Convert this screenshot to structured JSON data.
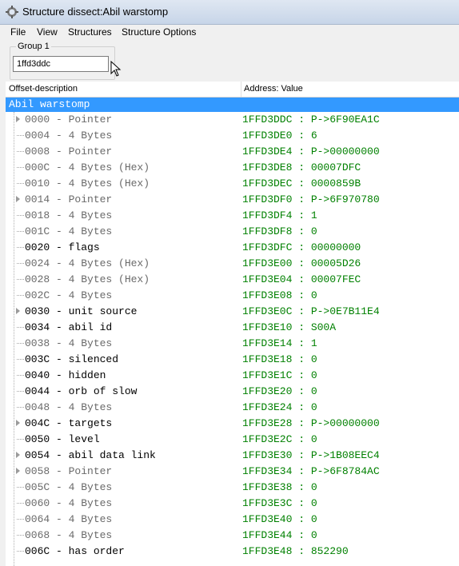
{
  "window": {
    "title": "Structure dissect:Abil warstomp"
  },
  "menu": [
    "File",
    "View",
    "Structures",
    "Structure Options"
  ],
  "group": {
    "label": "Group 1",
    "address": "1ffd3ddc"
  },
  "columns": {
    "offset": "Offset-description",
    "value": "Address: Value"
  },
  "root": {
    "label": "Abil warstomp"
  },
  "rows": [
    {
      "desc": "0000 - Pointer",
      "val": "1FFD3DDC : P->6F90EA1C",
      "expandable": true,
      "dim": true
    },
    {
      "desc": "0004 - 4 Bytes",
      "val": "1FFD3DE0 : 6",
      "expandable": false,
      "dim": true
    },
    {
      "desc": "0008 - Pointer",
      "val": "1FFD3DE4 : P->00000000",
      "expandable": false,
      "dim": true
    },
    {
      "desc": "000C - 4 Bytes (Hex)",
      "val": "1FFD3DE8 : 00007DFC",
      "expandable": false,
      "dim": true
    },
    {
      "desc": "0010 - 4 Bytes (Hex)",
      "val": "1FFD3DEC : 0000859B",
      "expandable": false,
      "dim": true
    },
    {
      "desc": "0014 - Pointer",
      "val": "1FFD3DF0 : P->6F970780",
      "expandable": true,
      "dim": true
    },
    {
      "desc": "0018 - 4 Bytes",
      "val": "1FFD3DF4 : 1",
      "expandable": false,
      "dim": true
    },
    {
      "desc": "001C - 4 Bytes",
      "val": "1FFD3DF8 : 0",
      "expandable": false,
      "dim": true
    },
    {
      "desc": "0020 - flags",
      "val": "1FFD3DFC : 00000000",
      "expandable": false,
      "dim": false
    },
    {
      "desc": "0024 - 4 Bytes (Hex)",
      "val": "1FFD3E00 : 00005D26",
      "expandable": false,
      "dim": true
    },
    {
      "desc": "0028 - 4 Bytes (Hex)",
      "val": "1FFD3E04 : 00007FEC",
      "expandable": false,
      "dim": true
    },
    {
      "desc": "002C - 4 Bytes",
      "val": "1FFD3E08 : 0",
      "expandable": false,
      "dim": true
    },
    {
      "desc": "0030 - unit source",
      "val": "1FFD3E0C : P->0E7B11E4",
      "expandable": true,
      "dim": false
    },
    {
      "desc": "0034 - abil id",
      "val": "1FFD3E10 : S00A",
      "expandable": false,
      "dim": false
    },
    {
      "desc": "0038 - 4 Bytes",
      "val": "1FFD3E14 : 1",
      "expandable": false,
      "dim": true
    },
    {
      "desc": "003C - silenced",
      "val": "1FFD3E18 : 0",
      "expandable": false,
      "dim": false
    },
    {
      "desc": "0040 - hidden",
      "val": "1FFD3E1C : 0",
      "expandable": false,
      "dim": false
    },
    {
      "desc": "0044 - orb of slow",
      "val": "1FFD3E20 : 0",
      "expandable": false,
      "dim": false
    },
    {
      "desc": "0048 - 4 Bytes",
      "val": "1FFD3E24 : 0",
      "expandable": false,
      "dim": true
    },
    {
      "desc": "004C - targets",
      "val": "1FFD3E28 : P->00000000",
      "expandable": true,
      "dim": false
    },
    {
      "desc": "0050 - level",
      "val": "1FFD3E2C : 0",
      "expandable": false,
      "dim": false
    },
    {
      "desc": "0054 - abil data link",
      "val": "1FFD3E30 : P->1B08EEC4",
      "expandable": true,
      "dim": false
    },
    {
      "desc": "0058 - Pointer",
      "val": "1FFD3E34 : P->6F8784AC",
      "expandable": true,
      "dim": true
    },
    {
      "desc": "005C - 4 Bytes",
      "val": "1FFD3E38 : 0",
      "expandable": false,
      "dim": true
    },
    {
      "desc": "0060 - 4 Bytes",
      "val": "1FFD3E3C : 0",
      "expandable": false,
      "dim": true
    },
    {
      "desc": "0064 - 4 Bytes",
      "val": "1FFD3E40 : 0",
      "expandable": false,
      "dim": true
    },
    {
      "desc": "0068 - 4 Bytes",
      "val": "1FFD3E44 : 0",
      "expandable": false,
      "dim": true
    },
    {
      "desc": "006C - has order",
      "val": "1FFD3E48 : 852290",
      "expandable": false,
      "dim": false
    }
  ]
}
